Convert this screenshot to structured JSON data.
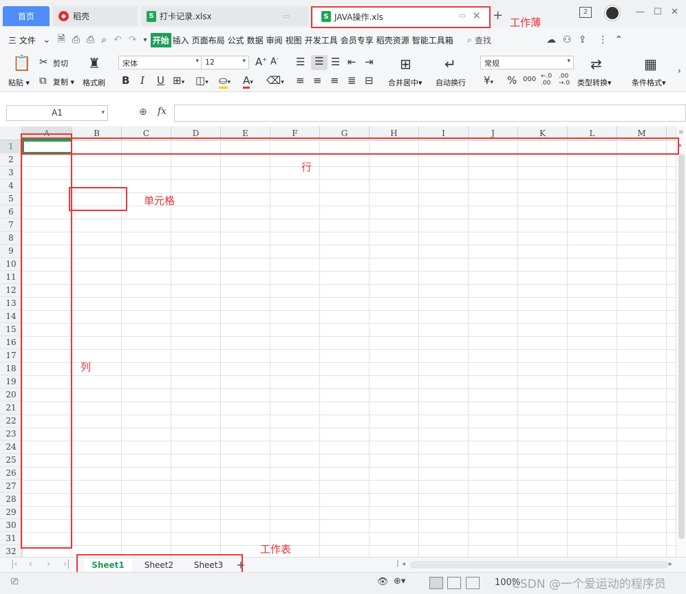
{
  "tabs": {
    "home": "首页",
    "wps": "稻壳",
    "file1": "打卡记录.xlsx",
    "file2": "JAVA操作.xls",
    "add": "+",
    "badge": "2",
    "file_icon": "S"
  },
  "menu": {
    "file": "三 文件",
    "items": [
      "开始",
      "插入",
      "页面布局",
      "公式",
      "数据",
      "审阅",
      "视图",
      "开发工具",
      "会员专享",
      "稻壳资源",
      "智能工具箱"
    ],
    "search": "查找"
  },
  "ribbon": {
    "paste": "粘贴",
    "cut": "剪切",
    "copy": "复制",
    "format_painter": "格式刷",
    "font_name": "宋体",
    "font_size": "12",
    "merge_center": "合并居中",
    "wrap_text": "自动换行",
    "number_format": "常规",
    "type_convert": "类型转换",
    "cond_format": "条件格式",
    "bold": "B",
    "italic": "I",
    "underline": "U",
    "font_color_label": "A",
    "currency": "¥",
    "percent": "%",
    "thousands": "000",
    "dec_inc": "←.0 .00",
    "dec_dec": ".00 →.0"
  },
  "formula_bar": {
    "cell_ref": "A1",
    "fx_label": "fx",
    "formula": ""
  },
  "grid": {
    "columns": [
      "A",
      "B",
      "C",
      "D",
      "E",
      "F",
      "G",
      "H",
      "I",
      "J",
      "K",
      "L",
      "M"
    ],
    "rows": [
      "1",
      "2",
      "3",
      "4",
      "5",
      "6",
      "7",
      "8",
      "9",
      "10",
      "11",
      "12",
      "13",
      "14",
      "15",
      "16",
      "17",
      "18",
      "19",
      "20",
      "21",
      "22",
      "23",
      "24",
      "25",
      "26",
      "27",
      "28",
      "29",
      "30",
      "31",
      "32"
    ],
    "selected_cell": "A1"
  },
  "annotations": {
    "workbook": "工作薄",
    "row": "行",
    "cell": "单元格",
    "column": "列",
    "worksheet": "工作表"
  },
  "sheets": {
    "tabs": [
      "Sheet1",
      "Sheet2",
      "Sheet3"
    ],
    "active": "Sheet1",
    "add": "+"
  },
  "statusbar": {
    "zoom": "100%",
    "watermark": "CSDN @一个爱运动的程序员"
  },
  "colors": {
    "accent": "#1e9e5a",
    "home_tab": "#4f8ef7",
    "annotation_red": "#e83535"
  }
}
